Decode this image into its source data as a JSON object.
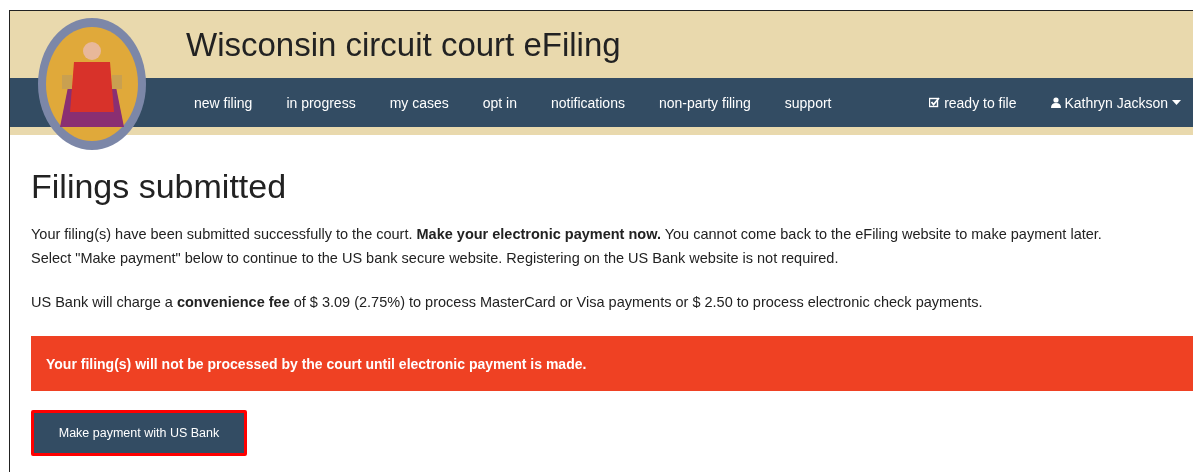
{
  "header": {
    "title": "Wisconsin circuit court eFiling"
  },
  "nav": {
    "items": [
      {
        "label": "new filing"
      },
      {
        "label": "in progress"
      },
      {
        "label": "my cases"
      },
      {
        "label": "opt in"
      },
      {
        "label": "notifications"
      },
      {
        "label": "non-party filing"
      },
      {
        "label": "support"
      }
    ],
    "right": [
      {
        "kind": "ready",
        "label": "ready to file"
      },
      {
        "kind": "user",
        "label": "Kathryn Jackson"
      }
    ]
  },
  "page": {
    "heading": "Filings submitted",
    "paragraphs": [
      "Your filing(s) have been submitted successfully to the court. **Make your electronic payment now.** You cannot come back to the eFiling website to make payment later. Select \"Make payment\" below to continue to the US bank secure website. Registering on the US Bank website is not required.",
      "US Bank will charge a **convenience fee** of $ 3.09 (2.75%) to process MasterCard or Visa payments or $ 2.50 to process electronic check payments."
    ],
    "alert": "Your filing(s) will not be processed by the court until electronic payment is made.",
    "button": {
      "label": "Make payment with US Bank",
      "highlighted": true
    }
  }
}
